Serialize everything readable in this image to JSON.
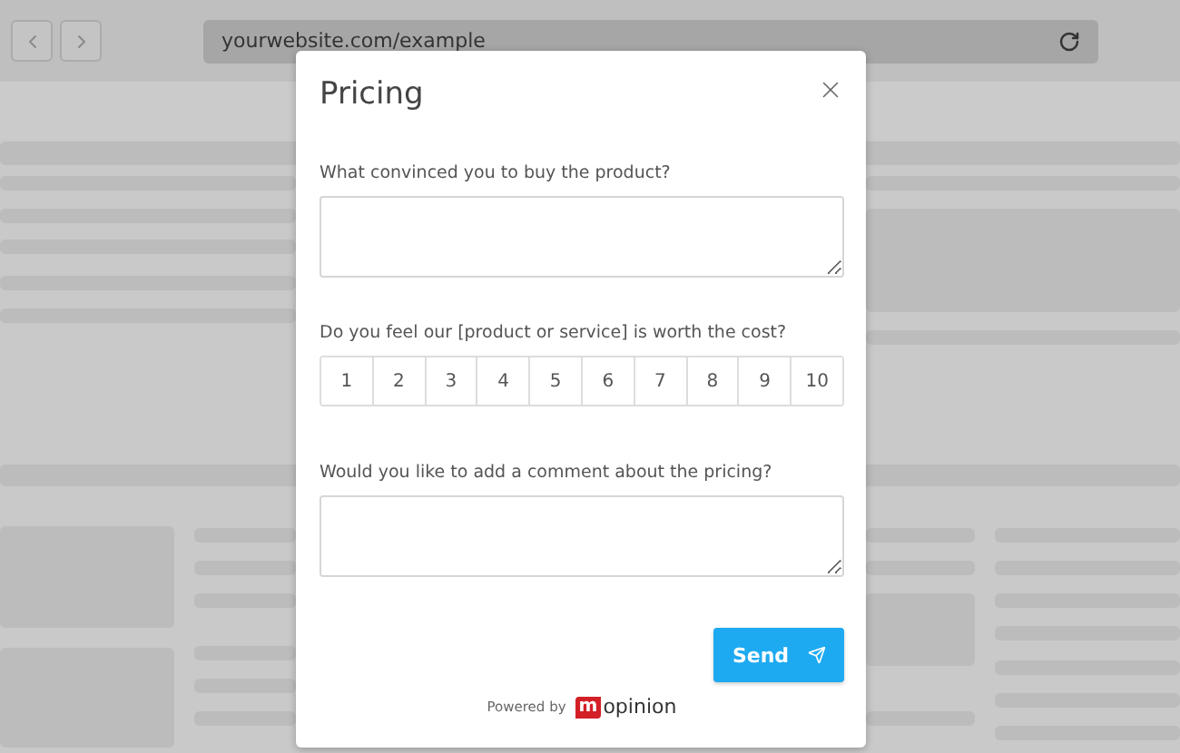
{
  "browser": {
    "url": "yourwebsite.com/example"
  },
  "dialog": {
    "title": "Pricing",
    "questions": [
      {
        "kind": "text",
        "label": "What convinced you to buy the product?"
      },
      {
        "kind": "scale",
        "label": "Do you feel our [product or service] is worth the cost?",
        "options": [
          {
            "label": "1",
            "selected": false
          },
          {
            "label": "2",
            "selected": false
          },
          {
            "label": "3",
            "selected": false
          },
          {
            "label": "4",
            "selected": false
          },
          {
            "label": "5",
            "selected": false
          },
          {
            "label": "6",
            "selected": false
          },
          {
            "label": "7",
            "selected": false
          },
          {
            "label": "8",
            "selected": false
          },
          {
            "label": "9",
            "selected": false
          },
          {
            "label": "10",
            "selected": false
          }
        ]
      },
      {
        "kind": "text",
        "label": "Would you like to add a comment about the pricing?"
      }
    ],
    "submit": "Send",
    "footer": {
      "prefix": "Powered by",
      "logo_badge": "m",
      "logo_text": "opinion"
    }
  }
}
